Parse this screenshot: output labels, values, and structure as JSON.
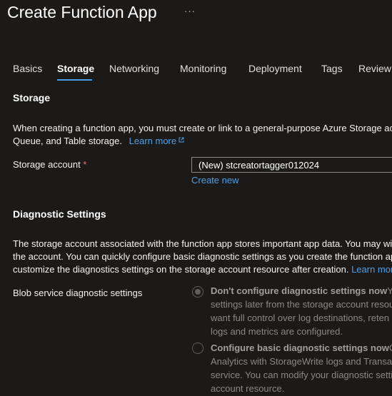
{
  "page": {
    "title": "Create Function App",
    "more_label": "···"
  },
  "tabs": [
    {
      "label": "Basics"
    },
    {
      "label": "Storage"
    },
    {
      "label": "Networking"
    },
    {
      "label": "Monitoring"
    },
    {
      "label": "Deployment"
    },
    {
      "label": "Tags"
    },
    {
      "label": "Review"
    }
  ],
  "storage": {
    "heading": "Storage",
    "desc_line1": "When creating a function app, you must create or link to a general-purpose Azure Storage ac",
    "desc_line2": "Queue, and Table storage.",
    "learn_more": "Learn more",
    "account_label": "Storage account",
    "required_mark": "*",
    "account_value": "(New) stcreatortagger012024",
    "create_new": "Create new"
  },
  "diagnostic": {
    "heading": "Diagnostic Settings",
    "desc_line1": "The storage account associated with the function app stores important app data. You may wi",
    "desc_line2": "the account. You can quickly configure basic diagnostic settings as you create the function ap",
    "desc_line3": "customize the diagnostics settings on the storage account resource after creation.",
    "learn_more": "Learn mor",
    "blob_label": "Blob service diagnostic settings",
    "option1": {
      "title": "Don't configure diagnostic settings now",
      "line1_rest": "Yo",
      "line2": "settings later from the storage account resou",
      "line3": "want full control over log destinations, reten",
      "line4": "logs and metrics are configured."
    },
    "option2": {
      "title": "Configure basic diagnostic settings now",
      "line1_rest": "Co",
      "line2": "Analytics with StorageWrite logs and Transac",
      "line3": "service. You can modify your diagnostic setti",
      "line4": "account resource."
    }
  },
  "colors": {
    "accent": "#4f9fe6",
    "background": "#1b1a19",
    "required": "#f1707b"
  }
}
